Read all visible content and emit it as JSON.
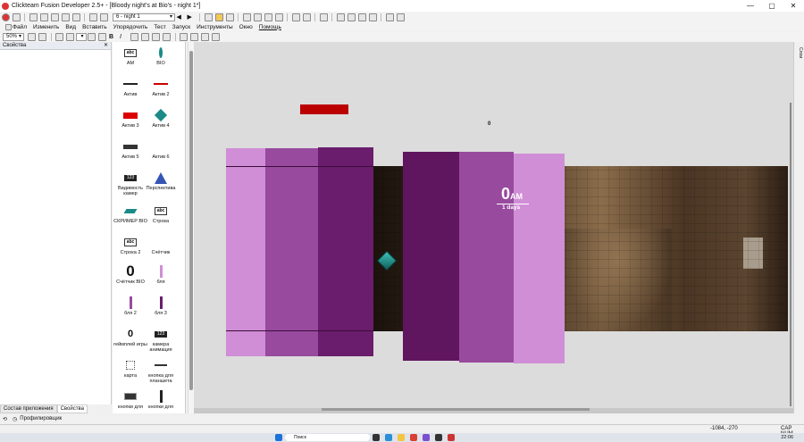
{
  "window": {
    "title": "Clickteam Fusion Developer 2.5+ - [Bloody night's at Bio's - night 1*]"
  },
  "toolbar": {
    "frame_select": "6 - night 1"
  },
  "menu": [
    "Файл",
    "Изменить",
    "Вид",
    "Вставить",
    "Упорядочить",
    "Тест",
    "Запуск",
    "Инструменты",
    "Окно",
    "Помощь"
  ],
  "toolbar2": {
    "zoom": "50%"
  },
  "props_panel": {
    "title": "Свойства",
    "pin": "✕"
  },
  "tabs": {
    "workspace": "Состав приложения",
    "properties": "Свойства"
  },
  "profiler": {
    "label": "Профилировщик"
  },
  "objects": [
    {
      "label": "AM",
      "icon": "abc-text-icon"
    },
    {
      "label": "BIO",
      "icon": "teal-leaf-icon"
    },
    {
      "label": "Актив",
      "icon": "bar-dark-icon"
    },
    {
      "label": "Актив 2",
      "icon": "bar-red-icon"
    },
    {
      "label": "Актив 3",
      "icon": "red-block-icon"
    },
    {
      "label": "Актив 4",
      "icon": "teal-gem-icon"
    },
    {
      "label": "Актив 5",
      "icon": "black-strip-icon"
    },
    {
      "label": "Актив 6",
      "icon": "none"
    },
    {
      "label": "Видимость камер",
      "icon": "counter-icon"
    },
    {
      "label": "Перспектива",
      "icon": "perspective-icon"
    },
    {
      "label": "СКРИМЕР BIO",
      "icon": "teal-gem-small-icon"
    },
    {
      "label": "Строка",
      "icon": "abc-text-icon"
    },
    {
      "label": "Строка 2",
      "icon": "abc-text-icon"
    },
    {
      "label": "Счётчик",
      "icon": "none"
    },
    {
      "label": "Счётчик BIO",
      "icon": "big-zero-icon"
    },
    {
      "label": "бля",
      "icon": "pink-bar-icon"
    },
    {
      "label": "бля 2",
      "icon": "purple-bar-icon"
    },
    {
      "label": "бля 3",
      "icon": "dark-purple-bar-icon"
    },
    {
      "label": "геймплей игры",
      "icon": "zero-icon"
    },
    {
      "label": "камера анимация",
      "icon": "counter-icon"
    },
    {
      "label": "карта",
      "icon": "map-icon"
    },
    {
      "label": "кнопка для планшета",
      "icon": "dash-icon"
    },
    {
      "label": "кнопки для",
      "icon": "buttons-icon"
    },
    {
      "label": "кнопки для",
      "icon": "bar-vertical-icon"
    }
  ],
  "canvas": {
    "clock_time": "0",
    "clock_suffix": "AM",
    "night_label": "1 days",
    "counter_value": "0",
    "right_tab": "Слои"
  },
  "status": {
    "coords": "-1084, -270",
    "flags": "CAP  NUM"
  },
  "taskbar": {
    "search_placeholder": "Поиск",
    "clock": "22:06"
  },
  "colors": {
    "pink_light": "#d08ed6",
    "purple_mid": "#984a9e",
    "purple_dark": "#6a1d6c",
    "blood_red": "#bb0000",
    "teal": "#1a8a86"
  }
}
